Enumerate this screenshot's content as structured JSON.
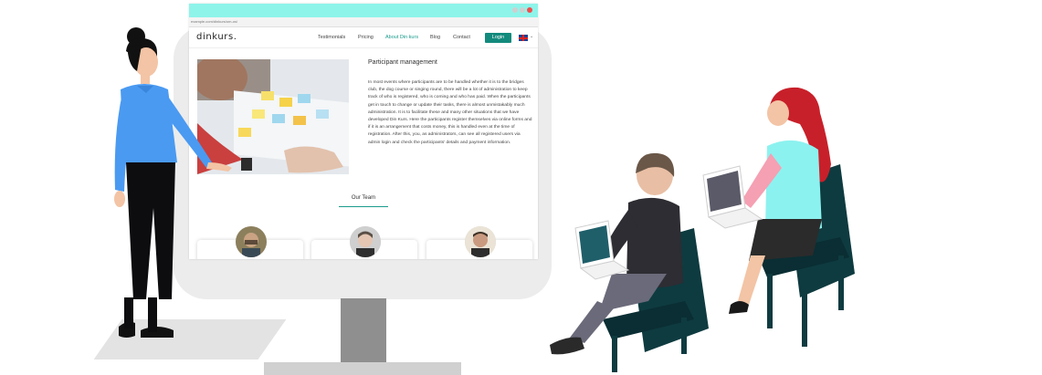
{
  "browser": {
    "url": "example.com/dinkurs/om-os/",
    "window_controls": [
      "minimize-icon",
      "maximize-icon",
      "close-icon"
    ]
  },
  "nav": {
    "logo": "dinkurs.",
    "items": [
      {
        "label": "Testimonials",
        "active": false
      },
      {
        "label": "Pricing",
        "active": false
      },
      {
        "label": "About Din kurs",
        "active": true
      },
      {
        "label": "Blog",
        "active": false
      },
      {
        "label": "Contact",
        "active": false
      }
    ],
    "login_label": "Login",
    "language_icon": "uk-flag-icon"
  },
  "article": {
    "title": "Participant management",
    "body": "In most events where participants are to be handled whether it is to the bridges club, the dog course or singing round, there will be a lot of administration to keep track of who is registered, who is coming and who has paid. When the participants get in touch to change or update their tasks, there is almost unmistakably much administration. It is to facilitate these and many other situations that we have developed Din Kurs. Here the participants register themselves via online forms and if it is an arrangement that costs money, this is handled even at the time of registration. After this, you, as administrators, can see all registered users via admin login and check the participants' details and payment information."
  },
  "team": {
    "title": "Our Team",
    "members": [
      {
        "avatar": "team-member-1"
      },
      {
        "avatar": "team-member-2"
      },
      {
        "avatar": "team-member-3"
      }
    ]
  },
  "colors": {
    "accent": "#128a7c",
    "tabbar": "#8ef4ea",
    "presenter_shirt": "#4a9af2",
    "attendee_sweater": "#2d2d33",
    "attendee_top": "#8cf2ef",
    "chair": "#0e3b40"
  }
}
